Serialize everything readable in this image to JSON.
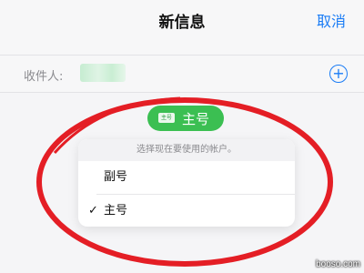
{
  "navbar": {
    "title": "新信息",
    "cancel_label": "取消"
  },
  "recipient_row": {
    "label": "收件人:",
    "add_icon_glyph": "+"
  },
  "line_selector": {
    "badge_text": "主号",
    "current_line": "主号",
    "color": "#3bbf52"
  },
  "line_menu": {
    "header": "选择现在要使用的帐户。",
    "items": [
      {
        "label": "副号",
        "check": ""
      },
      {
        "label": "主号",
        "check": "✓"
      }
    ]
  },
  "annotation": {
    "color": "#e41e25"
  },
  "watermark": {
    "text": "booso.com"
  },
  "colors": {
    "accent": "#1a7cf5",
    "background": "#f5f5f7"
  }
}
